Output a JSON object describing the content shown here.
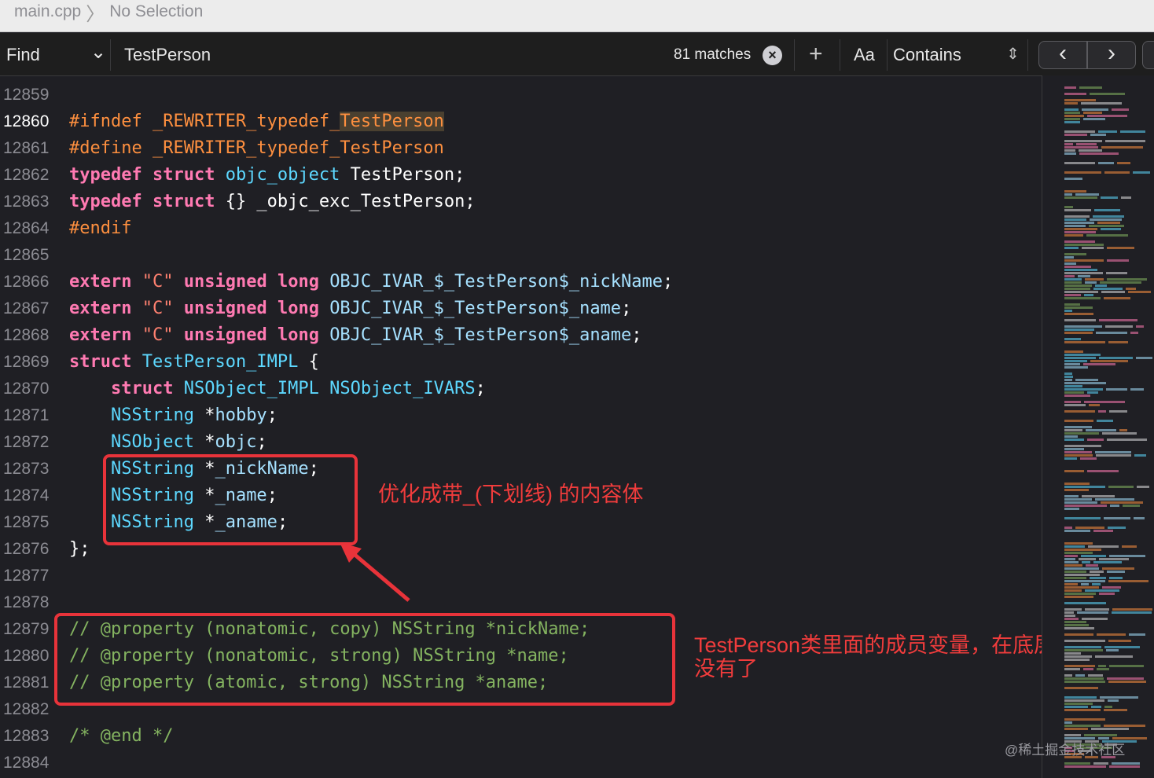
{
  "jumpbar": {
    "file": "main.cpp",
    "separator": "〉",
    "selection": "No Selection"
  },
  "findbar": {
    "mode": "Find",
    "mode_chevron": "⌄",
    "query": "TestPerson",
    "match_count": "81 matches",
    "clear": "×",
    "add": "+",
    "case_toggle": "Aa",
    "match_style": "Contains",
    "match_style_chevron": "⇕",
    "prev": "‹",
    "next": "›"
  },
  "annotations": {
    "note1": "优化成带_(下划线) 的内容体",
    "note2": "TestPerson类里面的成员变量，在底层中没有了"
  },
  "watermark": "@稀土掘金技术社区",
  "code_lines": [
    {
      "ln": "12859",
      "current": false,
      "tokens": []
    },
    {
      "ln": "12860",
      "current": true,
      "tokens": [
        {
          "t": "#ifndef _REWRITER_typedef_",
          "c": "pp"
        },
        {
          "t": "TestPerson",
          "c": "hl"
        }
      ]
    },
    {
      "ln": "12861",
      "current": false,
      "tokens": [
        {
          "t": "#define _REWRITER_typedef_TestPerson",
          "c": "pp"
        }
      ]
    },
    {
      "ln": "12862",
      "current": false,
      "tokens": [
        {
          "t": "typedef",
          "c": "kw"
        },
        {
          "t": " "
        },
        {
          "t": "struct",
          "c": "kw"
        },
        {
          "t": " "
        },
        {
          "t": "objc_object",
          "c": "ty"
        },
        {
          "t": " TestPerson;",
          "c": "plain"
        }
      ]
    },
    {
      "ln": "12863",
      "current": false,
      "tokens": [
        {
          "t": "typedef",
          "c": "kw"
        },
        {
          "t": " "
        },
        {
          "t": "struct",
          "c": "kw"
        },
        {
          "t": " {} _objc_exc_TestPerson;",
          "c": "plain"
        }
      ]
    },
    {
      "ln": "12864",
      "current": false,
      "tokens": [
        {
          "t": "#endif",
          "c": "pp"
        }
      ]
    },
    {
      "ln": "12865",
      "current": false,
      "tokens": []
    },
    {
      "ln": "12866",
      "current": false,
      "tokens": [
        {
          "t": "extern",
          "c": "kw"
        },
        {
          "t": " "
        },
        {
          "t": "\"C\"",
          "c": "str"
        },
        {
          "t": " "
        },
        {
          "t": "unsigned",
          "c": "kw"
        },
        {
          "t": " "
        },
        {
          "t": "long",
          "c": "kw"
        },
        {
          "t": " "
        },
        {
          "t": "OBJC_IVAR_$_TestPerson$_nickName",
          "c": "ty2"
        },
        {
          "t": ";",
          "c": "plain"
        }
      ]
    },
    {
      "ln": "12867",
      "current": false,
      "tokens": [
        {
          "t": "extern",
          "c": "kw"
        },
        {
          "t": " "
        },
        {
          "t": "\"C\"",
          "c": "str"
        },
        {
          "t": " "
        },
        {
          "t": "unsigned",
          "c": "kw"
        },
        {
          "t": " "
        },
        {
          "t": "long",
          "c": "kw"
        },
        {
          "t": " "
        },
        {
          "t": "OBJC_IVAR_$_TestPerson$_name",
          "c": "ty2"
        },
        {
          "t": ";",
          "c": "plain"
        }
      ]
    },
    {
      "ln": "12868",
      "current": false,
      "tokens": [
        {
          "t": "extern",
          "c": "kw"
        },
        {
          "t": " "
        },
        {
          "t": "\"C\"",
          "c": "str"
        },
        {
          "t": " "
        },
        {
          "t": "unsigned",
          "c": "kw"
        },
        {
          "t": " "
        },
        {
          "t": "long",
          "c": "kw"
        },
        {
          "t": " "
        },
        {
          "t": "OBJC_IVAR_$_TestPerson$_aname",
          "c": "ty2"
        },
        {
          "t": ";",
          "c": "plain"
        }
      ]
    },
    {
      "ln": "12869",
      "current": false,
      "tokens": [
        {
          "t": "struct",
          "c": "kw"
        },
        {
          "t": " "
        },
        {
          "t": "TestPerson_IMPL",
          "c": "ty"
        },
        {
          "t": " {",
          "c": "plain"
        }
      ]
    },
    {
      "ln": "12870",
      "current": false,
      "tokens": [
        {
          "t": "    "
        },
        {
          "t": "struct",
          "c": "kw"
        },
        {
          "t": " "
        },
        {
          "t": "NSObject_IMPL",
          "c": "ty"
        },
        {
          "t": " "
        },
        {
          "t": "NSObject_IVARS",
          "c": "ty"
        },
        {
          "t": ";",
          "c": "plain"
        }
      ]
    },
    {
      "ln": "12871",
      "current": false,
      "tokens": [
        {
          "t": "    "
        },
        {
          "t": "NSString",
          "c": "ty"
        },
        {
          "t": " *",
          "c": "plain"
        },
        {
          "t": "hobby",
          "c": "ty2"
        },
        {
          "t": ";",
          "c": "plain"
        }
      ]
    },
    {
      "ln": "12872",
      "current": false,
      "tokens": [
        {
          "t": "    "
        },
        {
          "t": "NSObject",
          "c": "ty"
        },
        {
          "t": " *",
          "c": "plain"
        },
        {
          "t": "objc",
          "c": "ty2"
        },
        {
          "t": ";",
          "c": "plain"
        }
      ]
    },
    {
      "ln": "12873",
      "current": false,
      "tokens": [
        {
          "t": "    "
        },
        {
          "t": "NSString",
          "c": "ty"
        },
        {
          "t": " *",
          "c": "plain"
        },
        {
          "t": "_nickName",
          "c": "ty2"
        },
        {
          "t": ";",
          "c": "plain"
        }
      ]
    },
    {
      "ln": "12874",
      "current": false,
      "tokens": [
        {
          "t": "    "
        },
        {
          "t": "NSString",
          "c": "ty"
        },
        {
          "t": " *",
          "c": "plain"
        },
        {
          "t": "_name",
          "c": "ty2"
        },
        {
          "t": ";",
          "c": "plain"
        }
      ]
    },
    {
      "ln": "12875",
      "current": false,
      "tokens": [
        {
          "t": "    "
        },
        {
          "t": "NSString",
          "c": "ty"
        },
        {
          "t": " *",
          "c": "plain"
        },
        {
          "t": "_aname",
          "c": "ty2"
        },
        {
          "t": ";",
          "c": "plain"
        }
      ]
    },
    {
      "ln": "12876",
      "current": false,
      "tokens": [
        {
          "t": "};",
          "c": "plain"
        }
      ]
    },
    {
      "ln": "12877",
      "current": false,
      "tokens": []
    },
    {
      "ln": "12878",
      "current": false,
      "tokens": []
    },
    {
      "ln": "12879",
      "current": false,
      "tokens": [
        {
          "t": "// @property (nonatomic, copy) NSString *nickName;",
          "c": "cm"
        }
      ]
    },
    {
      "ln": "12880",
      "current": false,
      "tokens": [
        {
          "t": "// @property (nonatomic, strong) NSString *name;",
          "c": "cm"
        }
      ]
    },
    {
      "ln": "12881",
      "current": false,
      "tokens": [
        {
          "t": "// @property (atomic, strong) NSString *aname;",
          "c": "cm"
        }
      ]
    },
    {
      "ln": "12882",
      "current": false,
      "tokens": []
    },
    {
      "ln": "12883",
      "current": false,
      "tokens": [
        {
          "t": "/* @end */",
          "c": "cm"
        }
      ]
    },
    {
      "ln": "12884",
      "current": false,
      "tokens": []
    }
  ],
  "colors": {
    "keyword": "#ff7ab2",
    "preprocessor": "#fd8f3f",
    "type": "#5dd8ff",
    "identifier": "#a6e1ff",
    "string": "#ff8170",
    "comment": "#84b360",
    "annotation": "#e8333a"
  }
}
